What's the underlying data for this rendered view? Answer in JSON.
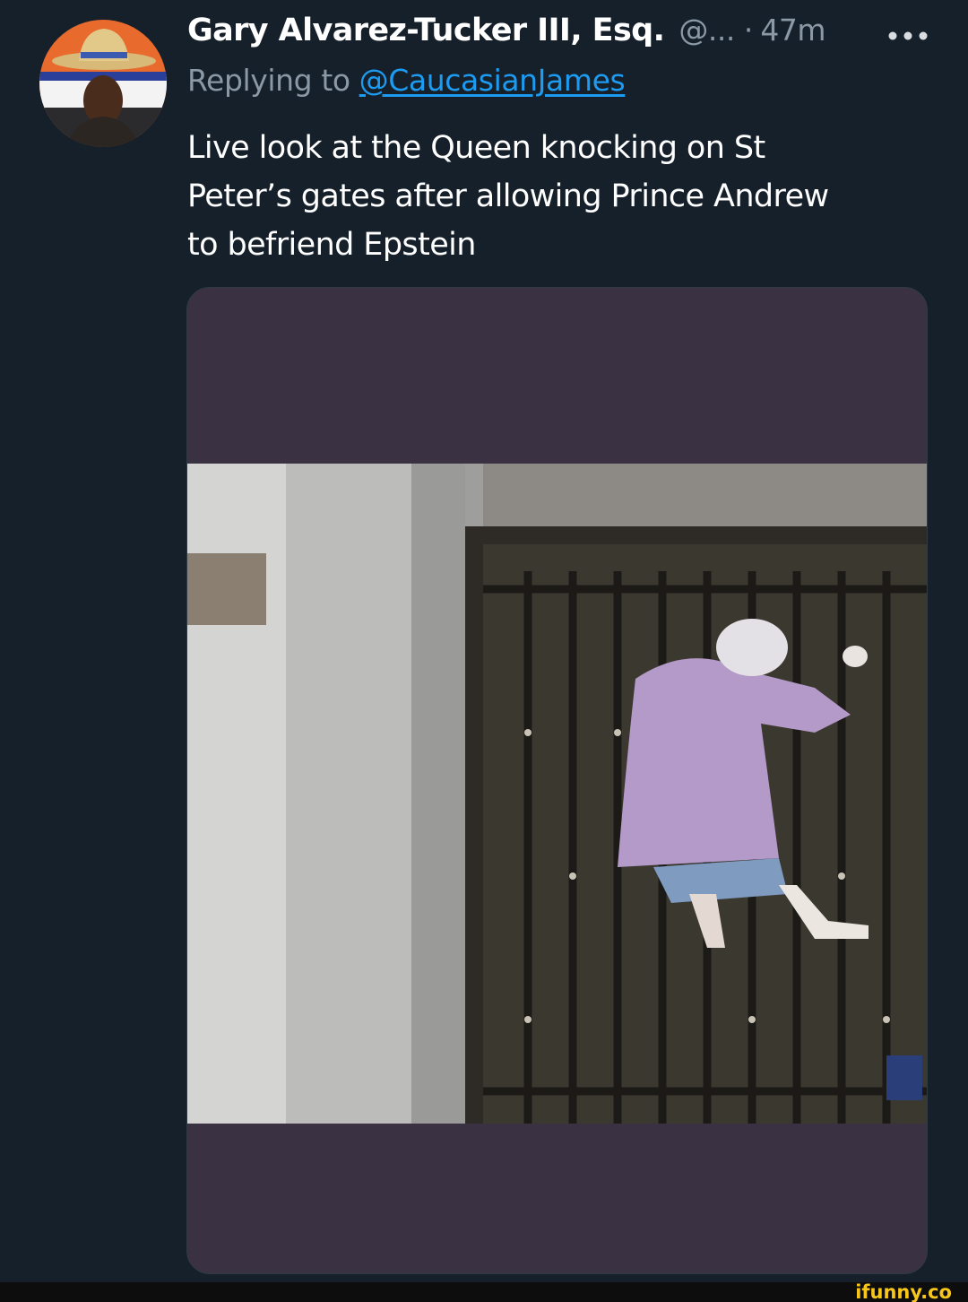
{
  "tweet": {
    "display_name": "Gary Alvarez-Tucker III, Esq.",
    "handle": "@...",
    "separator": "·",
    "timestamp": "47m",
    "more_label": "•••",
    "reply_prefix": "Replying to",
    "reply_to": "@CaucasianJames",
    "text_lines": [
      "Live look at the Queen knocking on St",
      "Peter’s gates after allowing Prince Andrew",
      "to befriend Epstein"
    ]
  },
  "watermark": "ifunny.co",
  "colors": {
    "background": "#15202b",
    "secondary_text": "#8b98a5",
    "link": "#1d9bf0",
    "media_letterbox": "#3a3142",
    "watermark": "#f7c61a"
  },
  "icons": {
    "more": "more-horizontal-icon"
  }
}
